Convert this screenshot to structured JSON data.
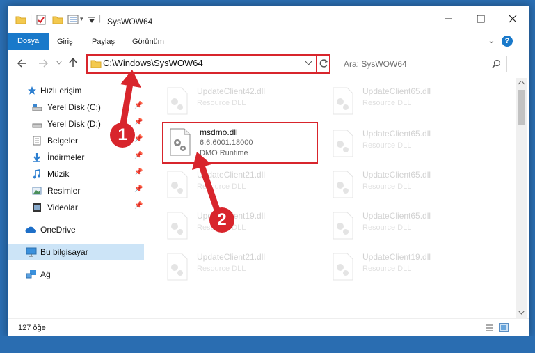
{
  "window": {
    "title": "SysWOW64",
    "quick_access_glyph": "▾"
  },
  "ribbon": {
    "tabs": [
      "Dosya",
      "Giriş",
      "Paylaş",
      "Görünüm"
    ],
    "collapse_glyph": "⌄",
    "help_glyph": "?"
  },
  "address": {
    "path": "C:\\Windows\\SysWOW64",
    "search_placeholder": "Ara: SysWOW64"
  },
  "sidebar": {
    "items": [
      {
        "label": "Hızlı erişim",
        "icon": "star-icon"
      },
      {
        "label": "Yerel Disk (C:)",
        "icon": "drive-icon",
        "pinned": true
      },
      {
        "label": "Yerel Disk (D:)",
        "icon": "drive-icon",
        "pinned": true
      },
      {
        "label": "Belgeler",
        "icon": "documents-icon",
        "pinned": true
      },
      {
        "label": "İndirmeler",
        "icon": "download-icon",
        "pinned": true
      },
      {
        "label": "Müzik",
        "icon": "music-icon",
        "pinned": true
      },
      {
        "label": "Resimler",
        "icon": "pictures-icon",
        "pinned": true
      },
      {
        "label": "Videolar",
        "icon": "videos-icon",
        "pinned": true
      },
      {
        "label": "OneDrive",
        "icon": "cloud-icon"
      },
      {
        "label": "Bu bilgisayar",
        "icon": "computer-icon",
        "selected": true
      },
      {
        "label": "Ağ",
        "icon": "network-icon"
      }
    ]
  },
  "files": {
    "left": [
      {
        "name": "UpdateClient42.dll",
        "desc": "Resource DLL"
      },
      {
        "name": "msdmo.dll",
        "version": "6.6.6001.18000",
        "desc": "DMO Runtime",
        "highlighted": true
      },
      {
        "name": "UpdateClient21.dll",
        "desc": "Resource DLL"
      },
      {
        "name": "UpdateClient19.dll",
        "desc": "Resource DLL"
      },
      {
        "name": "UpdateClient21.dll",
        "desc": "Resource DLL"
      }
    ],
    "right": [
      {
        "name": "UpdateClient65.dll",
        "desc": "Resource DLL"
      },
      {
        "name": "UpdateClient65.dll",
        "desc": "Resource DLL"
      },
      {
        "name": "UpdateClient65.dll",
        "desc": "Resource DLL"
      },
      {
        "name": "UpdateClient65.dll",
        "desc": "Resource DLL"
      },
      {
        "name": "UpdateClient19.dll",
        "desc": "Resource DLL"
      }
    ]
  },
  "status": {
    "item_count": "127 öğe"
  },
  "callouts": [
    "1",
    "2"
  ],
  "colors": {
    "accent": "#1979ca",
    "highlight": "#d8252c",
    "selection": "#cce4f7"
  }
}
